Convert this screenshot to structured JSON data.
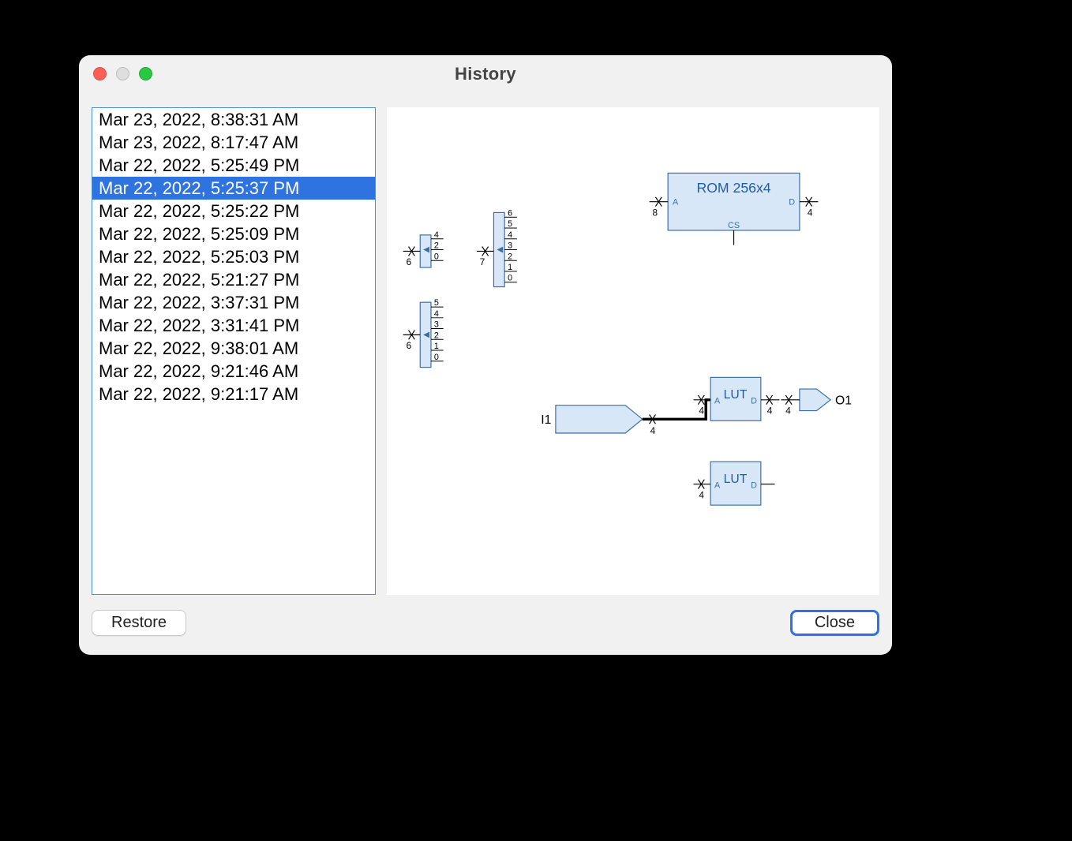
{
  "window": {
    "title": "History"
  },
  "history": {
    "items": [
      "Mar 23, 2022, 8:38:31 AM",
      "Mar 23, 2022, 8:17:47 AM",
      "Mar 22, 2022, 5:25:49 PM",
      "Mar 22, 2022, 5:25:37 PM",
      "Mar 22, 2022, 5:25:22 PM",
      "Mar 22, 2022, 5:25:09 PM",
      "Mar 22, 2022, 5:25:03 PM",
      "Mar 22, 2022, 5:21:27 PM",
      "Mar 22, 2022, 3:37:31 PM",
      "Mar 22, 2022, 3:31:41 PM",
      "Mar 22, 2022, 9:38:01 AM",
      "Mar 22, 2022, 9:21:46 AM",
      "Mar 22, 2022, 9:21:17 AM"
    ],
    "selected_index": 3
  },
  "buttons": {
    "restore": "Restore",
    "close": "Close"
  },
  "circuit": {
    "rom": {
      "label": "ROM 256x4",
      "port_a": "A",
      "port_d": "D",
      "port_cs": "CS",
      "bus_in": "8",
      "bus_out": "4"
    },
    "lut1": {
      "label": "LUT",
      "port_a": "A",
      "port_d": "D",
      "bus_in": "4",
      "bus_out": "4"
    },
    "lut2": {
      "label": "LUT",
      "port_a": "A",
      "port_d": "D",
      "bus_in": "4"
    },
    "in_pin": {
      "label": "I1",
      "bus": "4"
    },
    "out_pin": {
      "label": "O1",
      "bus": "4"
    },
    "splitter1": {
      "bus": "6",
      "bits": [
        "4",
        "2",
        "0"
      ]
    },
    "splitter2": {
      "bus": "7",
      "bits": [
        "6",
        "5",
        "4",
        "3",
        "2",
        "1",
        "0"
      ]
    },
    "splitter3": {
      "bus": "6",
      "bits": [
        "5",
        "4",
        "3",
        "2",
        "1",
        "0"
      ]
    }
  }
}
